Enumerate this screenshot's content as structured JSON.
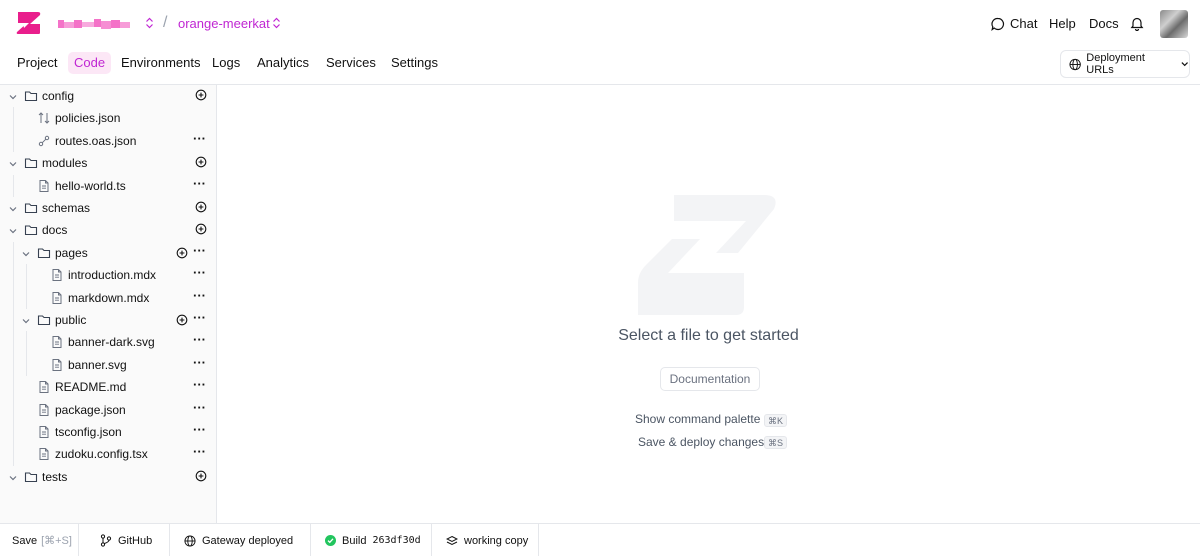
{
  "header": {
    "project_name": "orange-meerkat",
    "chat_label": "Chat",
    "help_label": "Help",
    "docs_label": "Docs"
  },
  "nav": {
    "tabs": [
      {
        "label": "Project"
      },
      {
        "label": "Code",
        "active": true
      },
      {
        "label": "Environments"
      },
      {
        "label": "Logs"
      },
      {
        "label": "Analytics"
      },
      {
        "label": "Services"
      },
      {
        "label": "Settings"
      }
    ],
    "deployment_urls_label": "Deployment URLs"
  },
  "tree": {
    "items": [
      {
        "label": "config",
        "type": "folder",
        "depth": 0,
        "expanded": true,
        "actions": "plus"
      },
      {
        "label": "policies.json",
        "type": "policies",
        "depth": 1,
        "actions": ""
      },
      {
        "label": "routes.oas.json",
        "type": "routes",
        "depth": 1,
        "actions": "dots"
      },
      {
        "label": "modules",
        "type": "folder",
        "depth": 0,
        "expanded": true,
        "actions": "plus"
      },
      {
        "label": "hello-world.ts",
        "type": "file",
        "depth": 1,
        "actions": "dots"
      },
      {
        "label": "schemas",
        "type": "folder",
        "depth": 0,
        "expanded": true,
        "actions": "plus"
      },
      {
        "label": "docs",
        "type": "folder",
        "depth": 0,
        "expanded": true,
        "actions": "plus"
      },
      {
        "label": "pages",
        "type": "folder",
        "depth": 1,
        "expanded": true,
        "actions": "both"
      },
      {
        "label": "introduction.mdx",
        "type": "file",
        "depth": 2,
        "actions": "dots"
      },
      {
        "label": "markdown.mdx",
        "type": "file",
        "depth": 2,
        "actions": "dots"
      },
      {
        "label": "public",
        "type": "folder",
        "depth": 1,
        "expanded": true,
        "actions": "both"
      },
      {
        "label": "banner-dark.svg",
        "type": "file",
        "depth": 2,
        "actions": "dots"
      },
      {
        "label": "banner.svg",
        "type": "file",
        "depth": 2,
        "actions": "dots"
      },
      {
        "label": "README.md",
        "type": "file",
        "depth": 1,
        "actions": "dots"
      },
      {
        "label": "package.json",
        "type": "file",
        "depth": 1,
        "actions": "dots"
      },
      {
        "label": "tsconfig.json",
        "type": "file",
        "depth": 1,
        "actions": "dots"
      },
      {
        "label": "zudoku.config.tsx",
        "type": "file",
        "depth": 1,
        "actions": "dots"
      },
      {
        "label": "tests",
        "type": "folder",
        "depth": 0,
        "expanded": true,
        "actions": "plus"
      }
    ]
  },
  "main": {
    "empty_title": "Select a file to get started",
    "documentation_label": "Documentation",
    "shortcuts": [
      {
        "label": "Show command palette",
        "key": "⌘K"
      },
      {
        "label": "Save & deploy changes",
        "key": "⌘S"
      }
    ]
  },
  "footer": {
    "save_label": "Save",
    "save_shortcut": "[⌘+S]",
    "github_label": "GitHub",
    "gateway_label": "Gateway deployed",
    "build_label": "Build",
    "build_hash": "263df30d",
    "working_copy_label": "working copy"
  },
  "colors": {
    "accent": "#e91e8c",
    "accent_text": "#c026d3",
    "active_tab_bg": "#fce7f6",
    "build_ok": "#22c55e"
  }
}
